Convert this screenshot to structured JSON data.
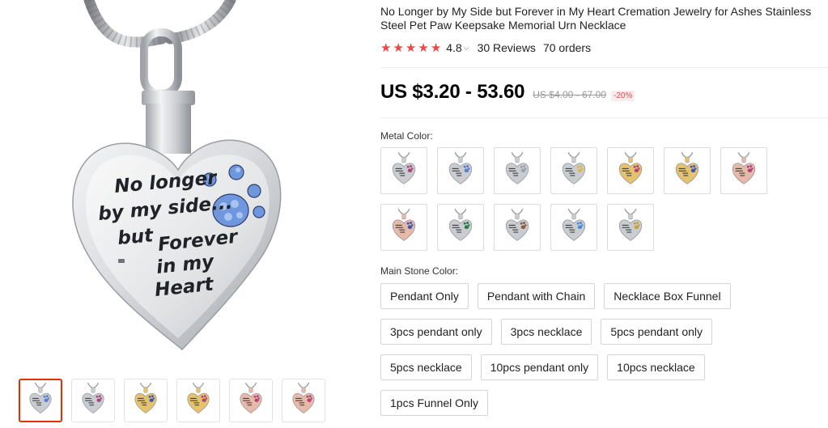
{
  "gallery": {
    "main_image": {
      "icon": "heart-pendant-image",
      "engraving_lines": [
        "No longer",
        "by my side...",
        "but",
        "Forever",
        "in my",
        "Heart"
      ]
    },
    "thumbnails": [
      {
        "icon": "pendant-silver-thumb",
        "metal": "#c9ccd1",
        "paw": "#5a7fd1",
        "active": true
      },
      {
        "icon": "pendant-silver-thumb",
        "metal": "#c9ccd1",
        "paw": "#b0457c"
      },
      {
        "icon": "pendant-gold-thumb",
        "metal": "#e5c26d",
        "paw": "#3c56b5"
      },
      {
        "icon": "pendant-gold-thumb",
        "metal": "#e5c26d",
        "paw": "#b0457c"
      },
      {
        "icon": "pendant-rose-thumb",
        "metal": "#e7b9a9",
        "paw": "#b0457c"
      },
      {
        "icon": "pendant-rose-thumb",
        "metal": "#e7b9a9",
        "paw": "#b0457c"
      }
    ]
  },
  "product": {
    "title": "No Longer by My Side but Forever in My Heart Cremation Jewelry for Ashes Stainless Steel Pet Paw Keepsake Memorial Urn Necklace",
    "rating": "4.8",
    "rating_stars": 5,
    "reviews": "30 Reviews",
    "orders": "70 orders",
    "price": "US $3.20 - 53.60",
    "old_price": "US $4.00 - 67.00",
    "discount": "-20%",
    "colors": {
      "accent": "#f04646",
      "border_active": "#e62e04"
    }
  },
  "metal_color": {
    "label": "Metal Color:",
    "swatches": [
      {
        "icon": "pendant-silver-swatch",
        "metal": "#c9ccd1",
        "paw": "#b0457c"
      },
      {
        "icon": "pendant-silver-swatch",
        "metal": "#c9ccd1",
        "paw": "#5a7fd1"
      },
      {
        "icon": "pendant-silver-swatch",
        "metal": "#c9ccd1",
        "paw": "#9aa2ad"
      },
      {
        "icon": "pendant-silver-swatch",
        "metal": "#c9ccd1",
        "paw": "#e0b84a"
      },
      {
        "icon": "pendant-gold-swatch",
        "metal": "#e5c26d",
        "paw": "#b0457c"
      },
      {
        "icon": "pendant-gold-swatch",
        "metal": "#e5c26d",
        "paw": "#3c56b5"
      },
      {
        "icon": "pendant-rose-swatch",
        "metal": "#e7b9a9",
        "paw": "#b0457c"
      },
      {
        "icon": "pendant-rose-swatch",
        "metal": "#e7b9a9",
        "paw": "#3c56b5"
      },
      {
        "icon": "pendant-silver-swatch",
        "metal": "#c9ccd1",
        "paw": "#2f7a44"
      },
      {
        "icon": "pendant-silver-swatch",
        "metal": "#c9ccd1",
        "paw": "#8a5a3a"
      },
      {
        "icon": "pendant-silver-swatch",
        "metal": "#c9ccd1",
        "paw": "#4a8bd1"
      },
      {
        "icon": "pendant-silver-swatch",
        "metal": "#c9ccd1",
        "paw": "#c7a23a"
      }
    ]
  },
  "main_stone_color": {
    "label": "Main Stone Color:",
    "options": [
      "Pendant Only",
      "Pendant with Chain",
      "Necklace Box Funnel",
      "3pcs pendant only",
      "3pcs necklace",
      "5pcs pendant only",
      "5pcs necklace",
      "10pcs pendant only",
      "10pcs necklace",
      "1pcs Funnel Only"
    ]
  }
}
